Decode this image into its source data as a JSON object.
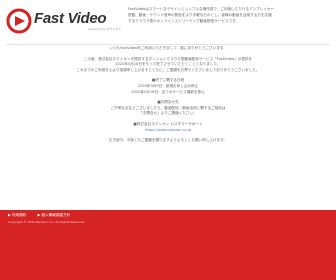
{
  "header": {
    "logo_text": "Fast Video",
    "logo_sub": "powered by ネクシオン",
    "desc_lines": [
      "FastVideoはスマートなデザインとシンプルな操作感で、ご利用いただけるアンプレイヤー",
      "搭載、動画・サウンド音声の配信をより手軽なものとし、皆様の動画を活用する方を応援",
      "するクラウド型のオンラインストリーミング動画配信サービスです。"
    ]
  },
  "main": {
    "lines": [
      "いつもFastVideoをご利用いただきまして、誠にありがとうございます。",
      "",
      "この度、株式会社ネクシオンが提供するダンジョンクラウド型動画配信サービス「FastVideo」の提供を",
      "2020年5月18日をもって終了させていただくこととなりました。",
      "これまでのご利用を心より感謝申し上げますとともに、ご愛顧をお寄せくださいましてありがとうございました。",
      "",
      "■終了に関する日程",
      "2020年3月9日：新規お申し込み停止",
      "2020年5月18日：全てのサービス機能を停止",
      "",
      "■お問合せ先",
      "ご不明な点などございましたら、動画配信・動画活用に関するご相談は",
      "「お問合せ」よりご連絡ください。",
      "",
      "■株式会社ネクシオン カスタマーサポート",
      "https://www.nexsion.co.jp",
      "",
      "引き続き、今後ともご愛顧を賜りますようよろしくお願い申し上げます。"
    ]
  },
  "footer": {
    "nav": [
      "▶ 利用規約",
      "▶ 個人情報保護方針"
    ],
    "copyright": "Copyright © 2020 Nexsion Inc. All Rights Reserved."
  }
}
